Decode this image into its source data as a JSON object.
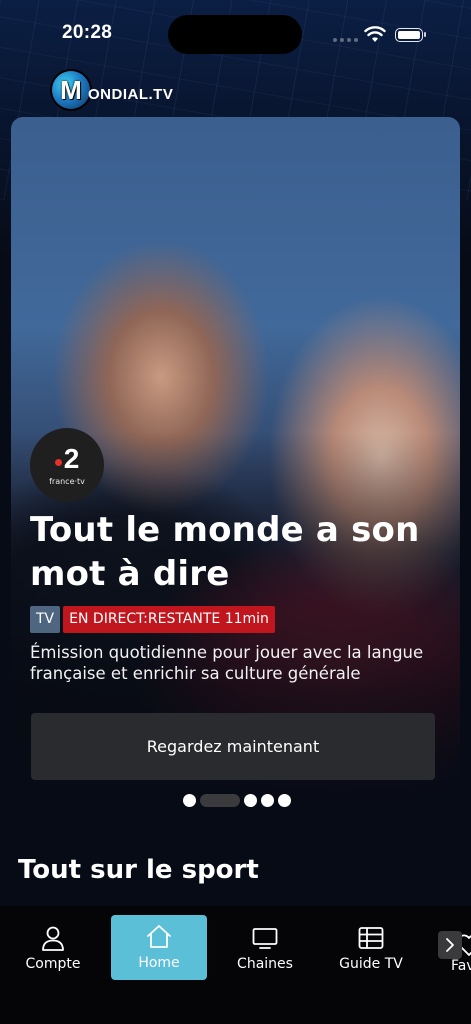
{
  "status_bar": {
    "time": "20:28"
  },
  "logo": {
    "globe_letter": "M",
    "text": "ONDIAL.TV"
  },
  "hero": {
    "channel_number": "2",
    "channel_name": "france·tv",
    "title": "Tout le monde a son mot à dire",
    "tag_type": "TV",
    "tag_live": "EN DIRECT:RESTANTE 11min",
    "description": "Émission quotidienne pour jouer avec la langue française et enrichir sa culture générale",
    "watch_button": "Regardez maintenant",
    "carousel": {
      "count": 5,
      "active_index": 1
    }
  },
  "section": {
    "title": "Tout sur le sport"
  },
  "bottom_nav": {
    "items": [
      {
        "label": "Compte",
        "icon": "person-icon"
      },
      {
        "label": "Home",
        "icon": "home-icon"
      },
      {
        "label": "Chaines",
        "icon": "tv-icon"
      },
      {
        "label": "Guide TV",
        "icon": "grid-icon"
      },
      {
        "label": "Fav",
        "icon": "heart-icon"
      }
    ],
    "active": "Home"
  },
  "colors": {
    "accent": "#5bbfd8",
    "live_tag": "#c1161d",
    "tv_tag": "#4f6680",
    "background": "#070b16"
  }
}
